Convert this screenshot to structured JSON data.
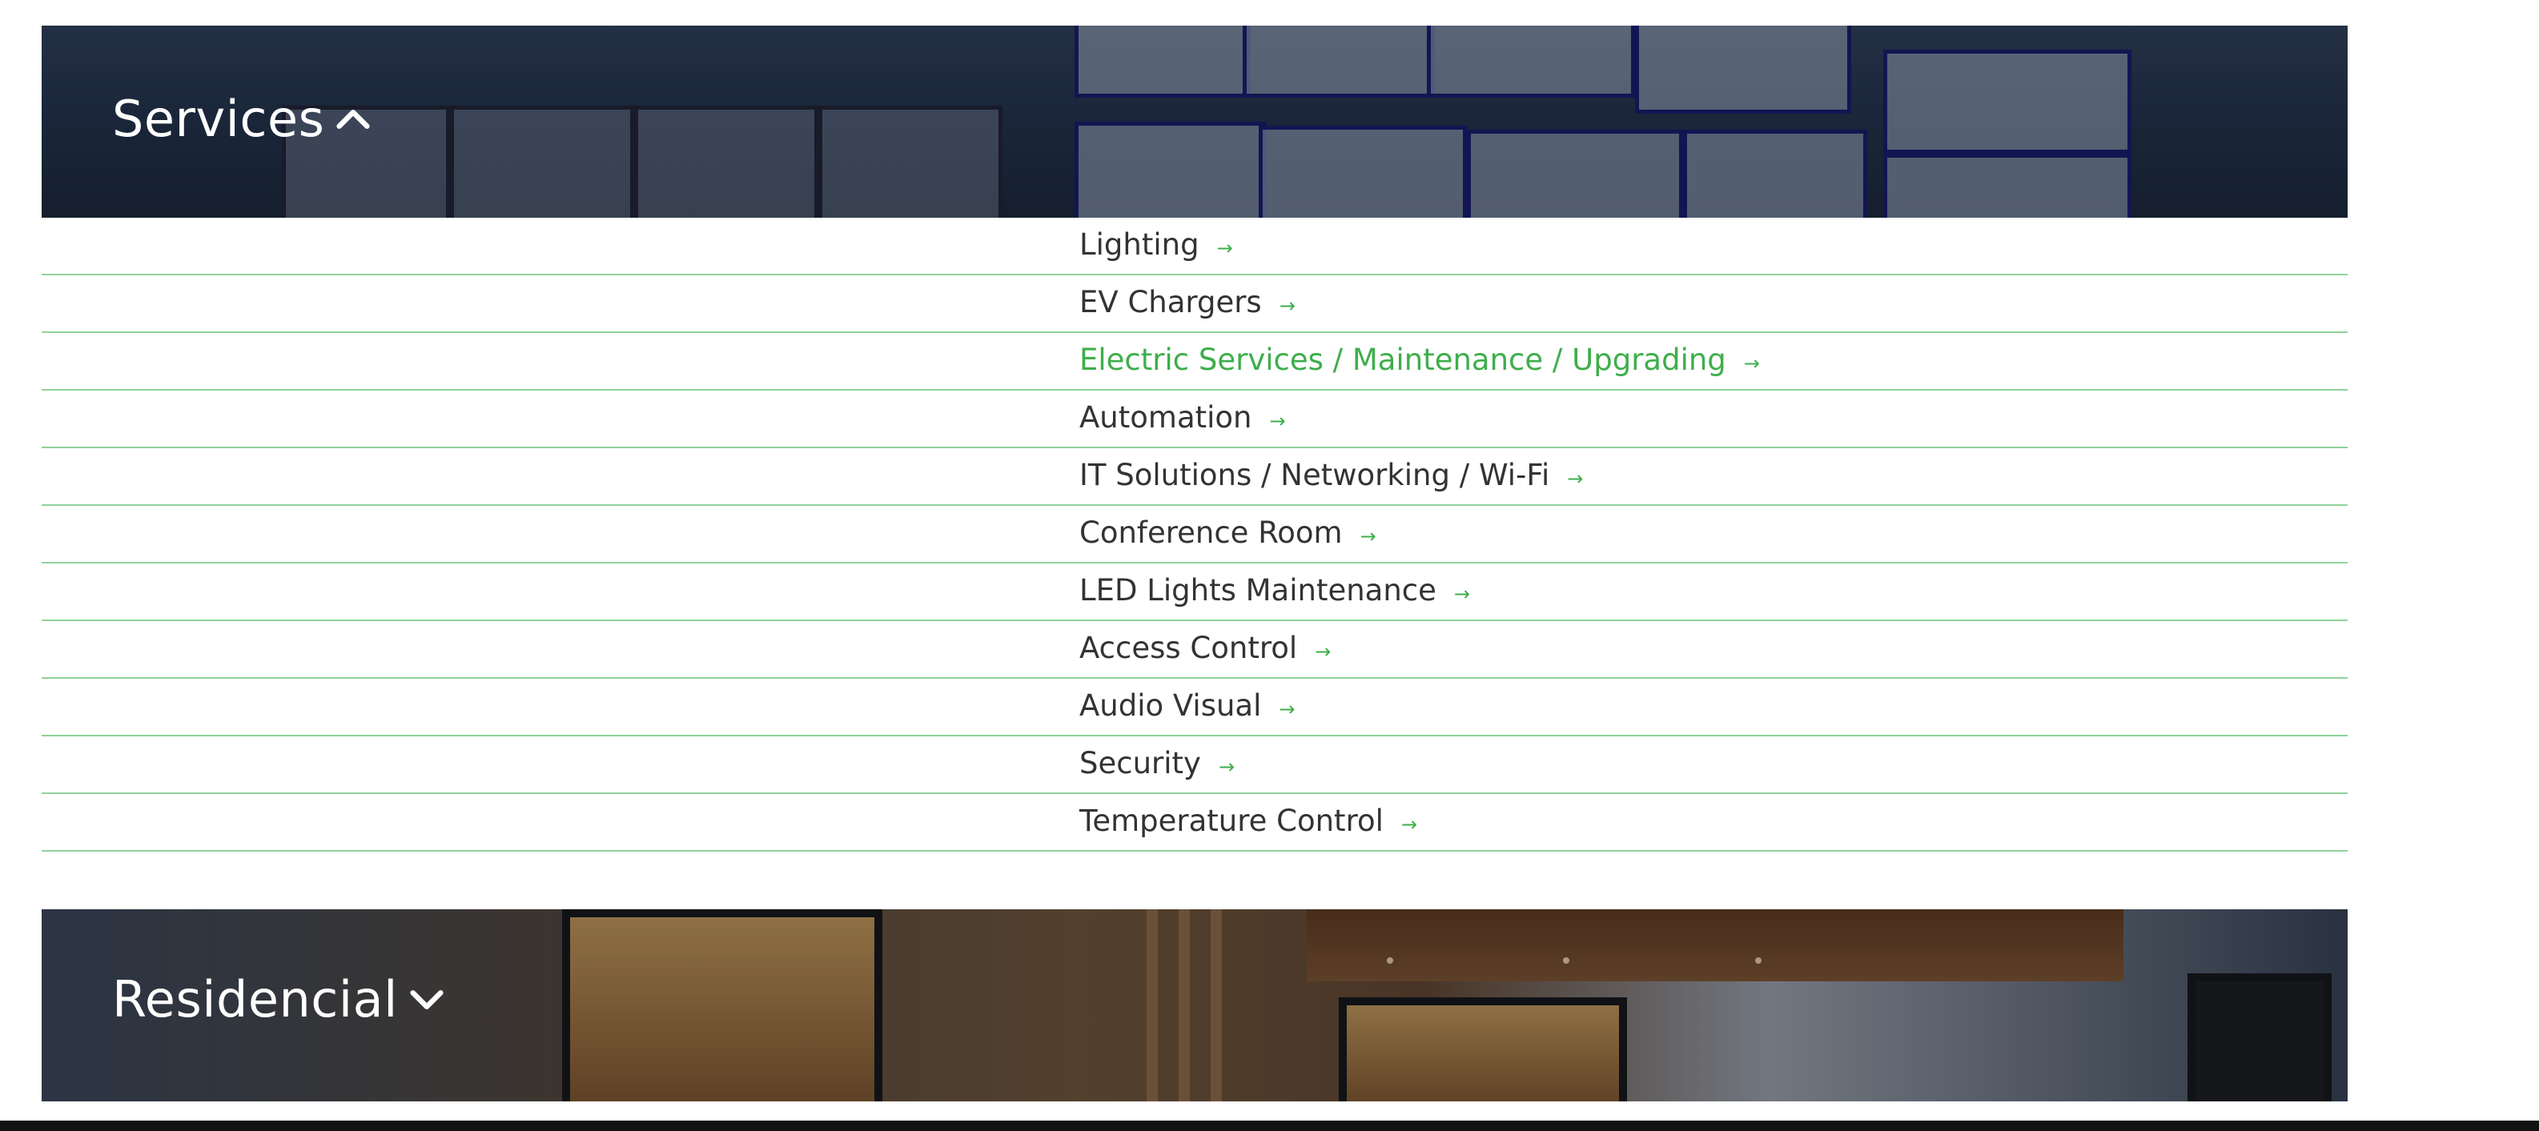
{
  "services_banner": {
    "title": "Services",
    "toggle_icon": "chevron-up-icon",
    "expanded": true
  },
  "services": [
    {
      "label": "Lighting",
      "arrow": "→",
      "active": false
    },
    {
      "label": "EV Chargers",
      "arrow": "→",
      "active": false
    },
    {
      "label": "Electric Services / Maintenance / Upgrading",
      "arrow": "→",
      "active": true
    },
    {
      "label": "Automation",
      "arrow": "→",
      "active": false
    },
    {
      "label": "IT Solutions / Networking / Wi-Fi",
      "arrow": "→",
      "active": false
    },
    {
      "label": "Conference Room",
      "arrow": "→",
      "active": false
    },
    {
      "label": "LED Lights Maintenance",
      "arrow": "→",
      "active": false
    },
    {
      "label": "Access Control",
      "arrow": "→",
      "active": false
    },
    {
      "label": "Audio Visual",
      "arrow": "→",
      "active": false
    },
    {
      "label": "Security",
      "arrow": "→",
      "active": false
    },
    {
      "label": "Temperature Control",
      "arrow": "→",
      "active": false
    }
  ],
  "residencial_banner": {
    "title": "Residencial",
    "toggle_icon": "chevron-down-icon",
    "expanded": false
  },
  "colors": {
    "accent": "#3eae4b",
    "divider": "#8fd29b",
    "text": "#333333",
    "title": "#ffffff"
  }
}
